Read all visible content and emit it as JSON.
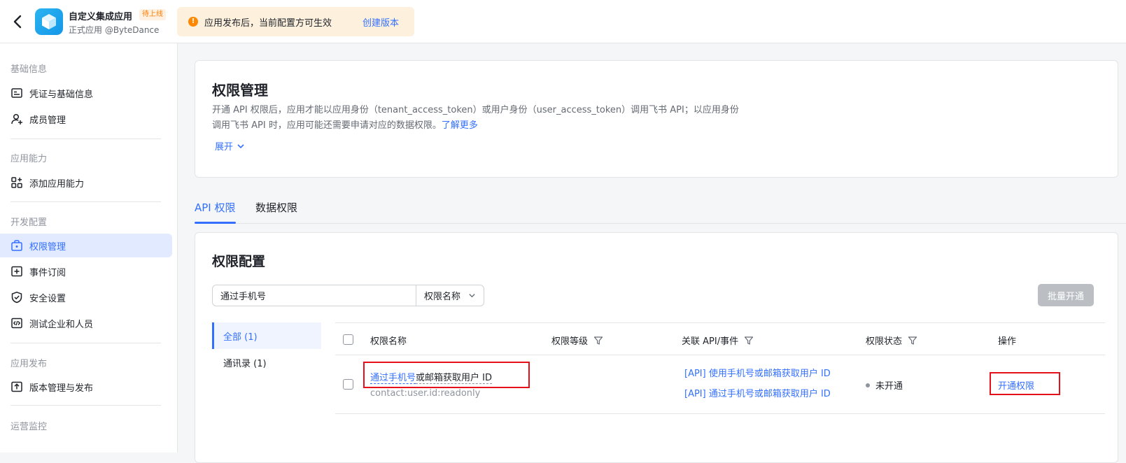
{
  "header": {
    "app_name": "自定义集成应用",
    "badge": "待上线",
    "app_sub": "正式应用 @ByteDance",
    "notice_text": "应用发布后，当前配置方可生效",
    "notice_link": "创建版本"
  },
  "sidebar": {
    "groups": [
      "基础信息",
      "应用能力",
      "开发配置",
      "应用发布",
      "运营监控"
    ],
    "items": [
      {
        "label": "凭证与基础信息",
        "icon": "id-card-icon"
      },
      {
        "label": "成员管理",
        "icon": "add-user-icon"
      },
      {
        "label": "添加应用能力",
        "icon": "grid-plus-icon"
      },
      {
        "label": "权限管理",
        "icon": "lock-box-icon",
        "active": true
      },
      {
        "label": "事件订阅",
        "icon": "subscribe-icon"
      },
      {
        "label": "安全设置",
        "icon": "shield-icon"
      },
      {
        "label": "测试企业和人员",
        "icon": "code-icon"
      },
      {
        "label": "版本管理与发布",
        "icon": "upload-icon"
      }
    ]
  },
  "intro": {
    "title": "权限管理",
    "desc_line1": "开通 API 权限后，应用才能以应用身份（tenant_access_token）或用户身份（user_access_token）调用飞书 API；以应用身份",
    "desc_line2": "调用飞书 API 时，应用可能还需要申请对应的数据权限。",
    "learn_more": "了解更多",
    "expand": "展开"
  },
  "tabs": [
    "API 权限",
    "数据权限"
  ],
  "config": {
    "title": "权限配置",
    "search_value": "通过手机号",
    "select_value": "权限名称",
    "batch_button": "批量开通",
    "categories": [
      "全部 (1)",
      "通讯录 (1)"
    ],
    "columns": [
      "权限名称",
      "权限等级",
      "关联 API/事件",
      "权限状态",
      "操作"
    ],
    "rows": [
      {
        "name_highlight": "通过手机号",
        "name_rest": "或邮箱获取用户 ID",
        "code": "contact:user.id:readonly",
        "apis": [
          "[API] 使用手机号或邮箱获取用户 ID",
          "[API] 通过手机号或邮箱获取用户 ID"
        ],
        "status": "未开通",
        "action": "开通权限"
      }
    ]
  },
  "colors": {
    "accent": "#3370ff",
    "highlight_box": "#e5101a",
    "warning": "#ff8800"
  }
}
